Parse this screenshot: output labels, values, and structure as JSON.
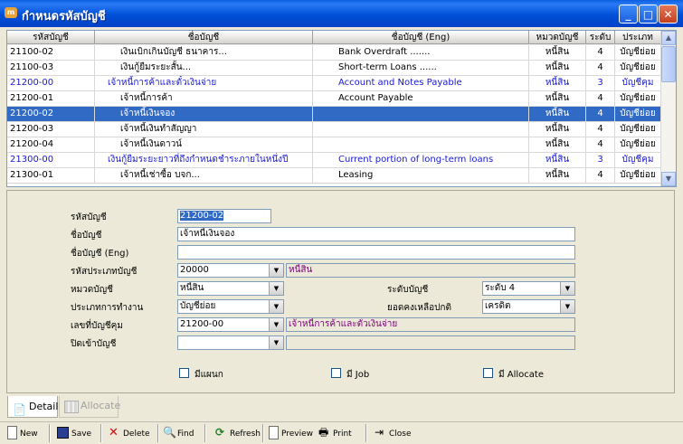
{
  "window": {
    "title": "กำหนดรหัสบัญชี"
  },
  "grid": {
    "columns": [
      "รหัสบัญชี",
      "ชื่อบัญชี",
      "ชื่อบัญชี (Eng)",
      "หมวดบัญชี",
      "ระดับ",
      "ประเภท"
    ],
    "rows": [
      {
        "code": "21100-02",
        "name": "เงินเบิกเกินบัญชี ธนาคาร...",
        "name_en": "Bank Overdraft .......",
        "group": "หนี้สิน",
        "level": "4",
        "type": "บัญชีย่อย",
        "kind": "normal"
      },
      {
        "code": "21100-03",
        "name": "เงินกู้ยืมระยะสั้น...",
        "name_en": "Short-term Loans ......",
        "group": "หนี้สิน",
        "level": "4",
        "type": "บัญชีย่อย",
        "kind": "normal"
      },
      {
        "code": "21200-00",
        "name": "เจ้าหนี้การค้าและตั๋วเงินจ่าย",
        "name_en": "Account and Notes Payable",
        "group": "หนี้สิน",
        "level": "3",
        "type": "บัญชีคุม",
        "kind": "group"
      },
      {
        "code": "21200-01",
        "name": "เจ้าหนี้การค้า",
        "name_en": "Account Payable",
        "group": "หนี้สิน",
        "level": "4",
        "type": "บัญชีย่อย",
        "kind": "normal"
      },
      {
        "code": "21200-02",
        "name": "เจ้าหนี้เงินจอง",
        "name_en": "",
        "group": "หนี้สิน",
        "level": "4",
        "type": "บัญชีย่อย",
        "kind": "selected"
      },
      {
        "code": "21200-03",
        "name": "เจ้าหนี้เงินทำสัญญา",
        "name_en": "",
        "group": "หนี้สิน",
        "level": "4",
        "type": "บัญชีย่อย",
        "kind": "normal"
      },
      {
        "code": "21200-04",
        "name": "เจ้าหนี้เงินดาวน์",
        "name_en": "",
        "group": "หนี้สิน",
        "level": "4",
        "type": "บัญชีย่อย",
        "kind": "normal"
      },
      {
        "code": "21300-00",
        "name": "เงินกู้ยืมระยะยาวที่ถึงกำหนดชำระภายในหนึ่งปี",
        "name_en": "Current portion of long-term loans",
        "group": "หนี้สิน",
        "level": "3",
        "type": "บัญชีคุม",
        "kind": "group"
      },
      {
        "code": "21300-01",
        "name": "เจ้าหนี้เช่าซื้อ บจก...",
        "name_en": "Leasing",
        "group": "หนี้สิน",
        "level": "4",
        "type": "บัญชีย่อย",
        "kind": "normal"
      }
    ]
  },
  "form": {
    "account_code_label": "รหัสบัญชี",
    "account_code_value": "21200-02",
    "account_name_label": "ชื่อบัญชี",
    "account_name_value": "เจ้าหนี้เงินจอง",
    "account_name_en_label": "ชื่อบัญชี (Eng)",
    "account_name_en_value": "",
    "account_type_code_label": "รหัสประเภทบัญชี",
    "account_type_code_value": "20000",
    "account_type_desc": "หนี้สิน",
    "account_group_label": "หมวดบัญชี",
    "account_group_value": "หนี้สิน",
    "account_level_label": "ระดับบัญชี",
    "account_level_value": "ระดับ 4",
    "operation_type_label": "ประเภทการทำงาน",
    "operation_type_value": "บัญชีย่อย",
    "normal_balance_label": "ยอดคงเหลือปกติ",
    "normal_balance_value": "เครดิต",
    "parent_account_label": "เลขที่บัญชีคุม",
    "parent_account_value": "21200-00",
    "parent_account_desc": "เจ้าหนี้การค้าและตั๋วเงินจ่าย",
    "close_to_label": "ปิดเข้าบัญชี",
    "close_to_value": "",
    "close_to_desc": "",
    "has_department_label": "มีแผนก",
    "has_job_label": "มี Job",
    "has_allocate_label": "มี Allocate"
  },
  "tabs": {
    "detail": "Detail",
    "allocate": "Allocate"
  },
  "toolbar": {
    "new": "New",
    "save": "Save",
    "delete": "Delete",
    "find": "Find",
    "refresh": "Refresh",
    "preview": "Preview",
    "print": "Print",
    "close": "Close"
  },
  "colors": {
    "title_bar": "#0050d8",
    "selection": "#316ac5",
    "group_row_text": "#1919d2",
    "readonly_text": "#800080"
  },
  "icons": [
    "app-icon",
    "minimize-icon",
    "maximize-icon",
    "close-icon",
    "new-icon",
    "save-icon",
    "delete-icon",
    "find-icon",
    "refresh-icon",
    "preview-icon",
    "print-icon",
    "exit-icon",
    "detail-tab-icon",
    "allocate-tab-icon"
  ]
}
